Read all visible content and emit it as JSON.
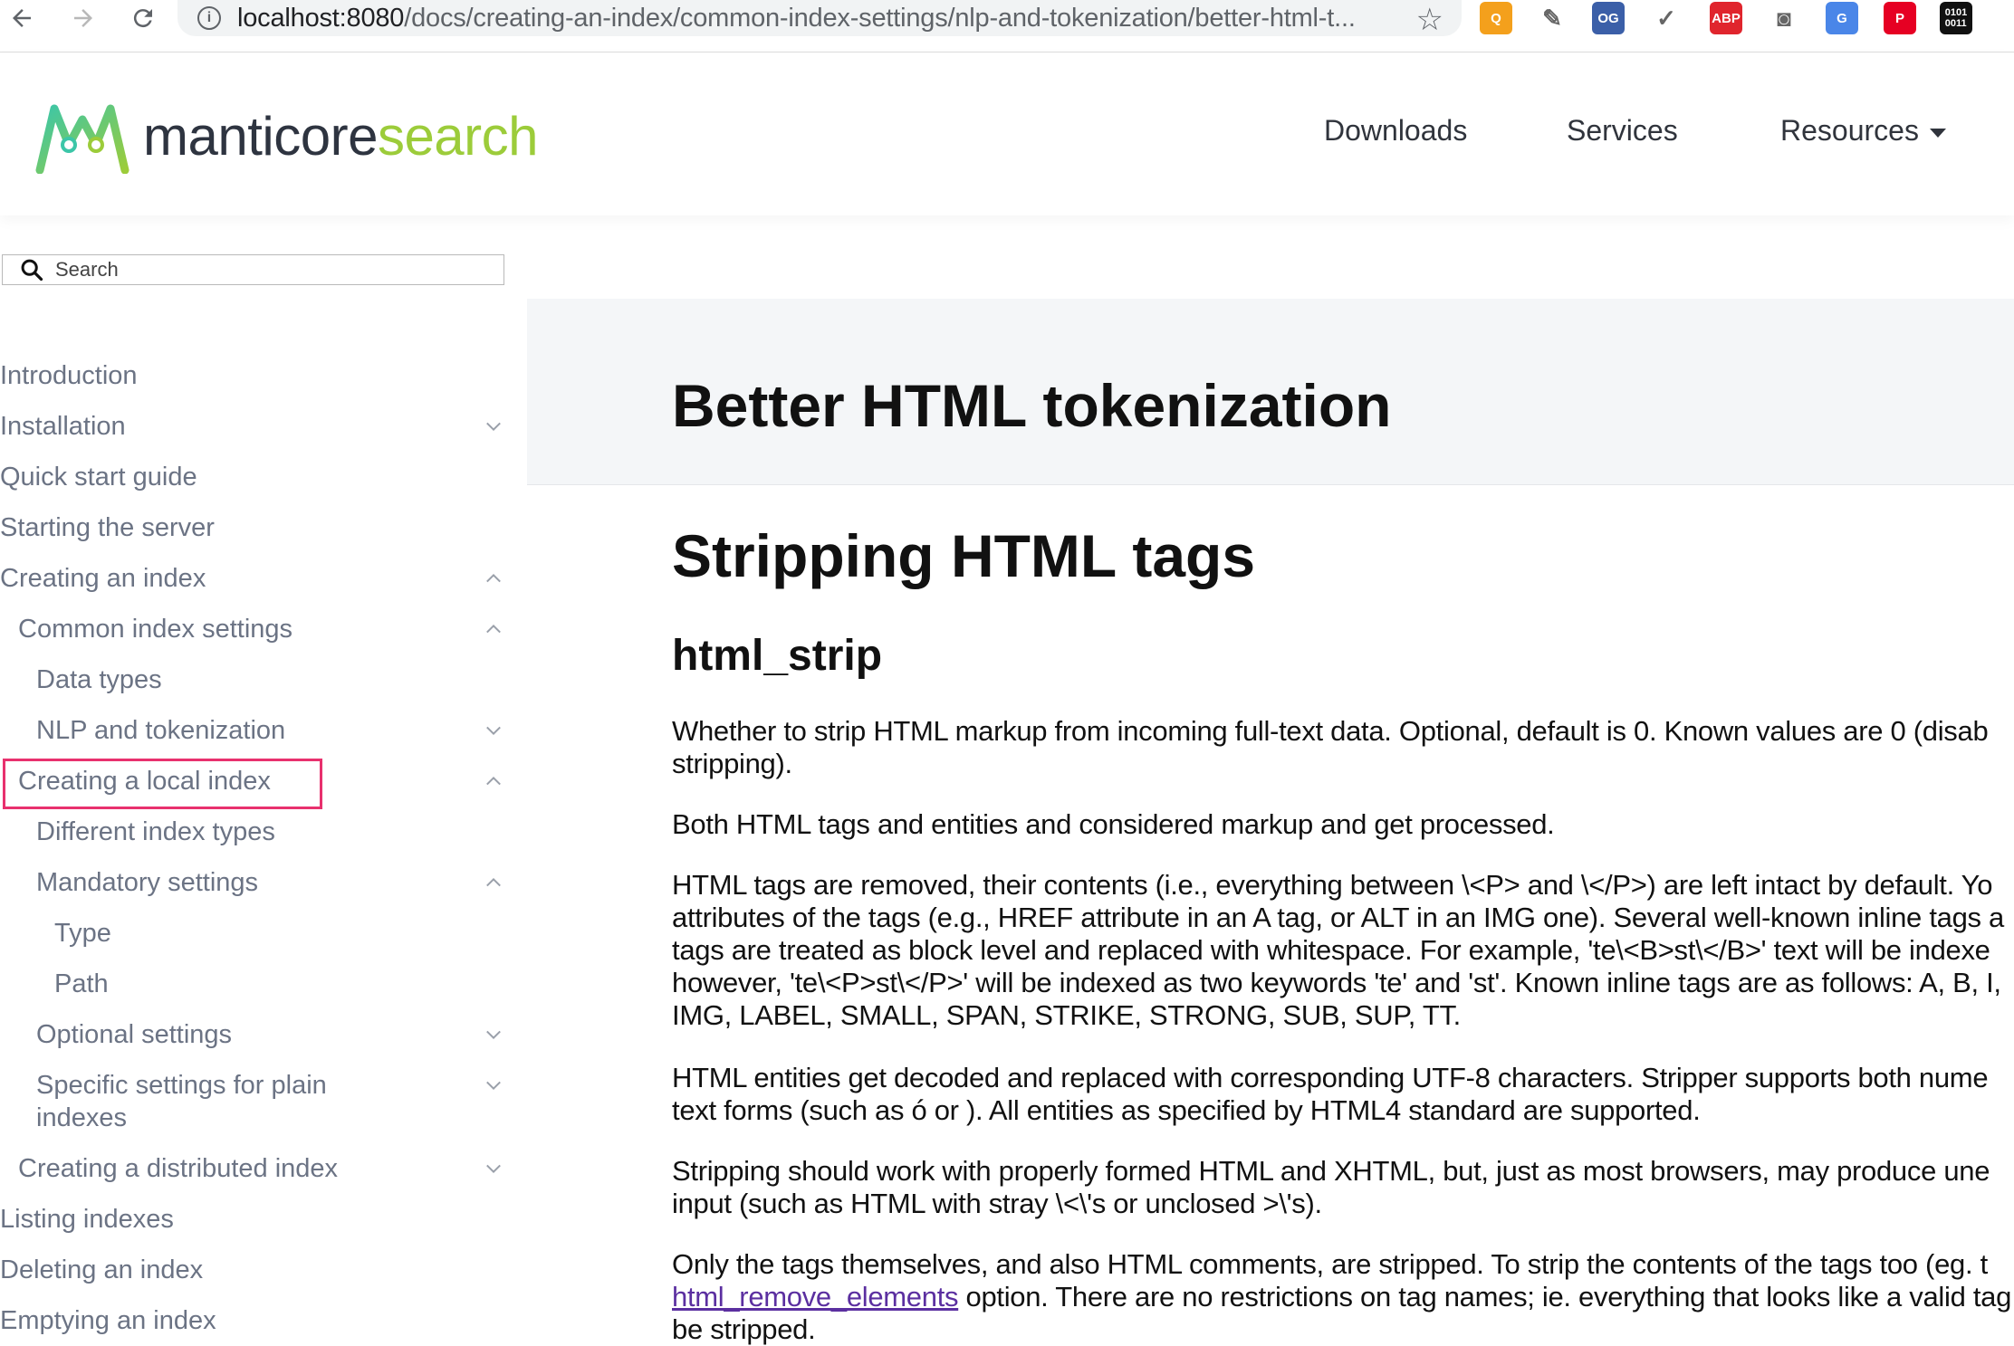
{
  "browser": {
    "url_host": "localhost:8080",
    "url_path": "/docs/creating-an-index/common-index-settings/nlp-and-tokenization/better-html-t...",
    "extensions": [
      {
        "name": "orange-search-extension-icon",
        "label": "Q",
        "color": "#f4a01c"
      },
      {
        "name": "eyedropper-extension-icon",
        "label": "",
        "color": "#ffffff"
      },
      {
        "name": "og-extension-icon",
        "label": "OG",
        "color": "#3b5fa8"
      },
      {
        "name": "check-extension-icon",
        "label": "",
        "color": "#ffffff"
      },
      {
        "name": "adblock-plus-extension-icon",
        "label": "ABP",
        "color": "#e0252d"
      },
      {
        "name": "camera-extension-icon",
        "label": "",
        "color": "#ffffff"
      },
      {
        "name": "translate-extension-icon",
        "label": "G",
        "color": "#4a86e8"
      },
      {
        "name": "pinterest-extension-icon",
        "label": "P",
        "color": "#e60023"
      },
      {
        "name": "binary-extension-icon",
        "label": "0101\n0011",
        "color": "#111111"
      }
    ]
  },
  "header": {
    "logo_main": "manticore",
    "logo_accent": "search",
    "nav": {
      "downloads": "Downloads",
      "services": "Services",
      "resources": "Resources"
    }
  },
  "sidebar": {
    "search_placeholder": "Search",
    "items": [
      {
        "label": "Introduction",
        "chevron": ""
      },
      {
        "label": "Installation",
        "chevron": "down"
      },
      {
        "label": "Quick start guide",
        "chevron": ""
      },
      {
        "label": "Starting the server",
        "chevron": ""
      },
      {
        "label": "Creating an index",
        "chevron": "up"
      },
      {
        "label": "Common index settings",
        "chevron": "up"
      },
      {
        "label": "Data types",
        "chevron": ""
      },
      {
        "label": "NLP and tokenization",
        "chevron": "down"
      },
      {
        "label": "Creating a local index",
        "chevron": "up"
      },
      {
        "label": "Different index types",
        "chevron": ""
      },
      {
        "label": "Mandatory settings",
        "chevron": "up"
      },
      {
        "label": "Type",
        "chevron": ""
      },
      {
        "label": "Path",
        "chevron": ""
      },
      {
        "label": "Optional settings",
        "chevron": "down"
      },
      {
        "label": "Specific settings for plain",
        "label2": "indexes",
        "chevron": "down"
      },
      {
        "label": "Creating a distributed index",
        "chevron": "down"
      },
      {
        "label": "Listing indexes",
        "chevron": ""
      },
      {
        "label": "Deleting an index",
        "chevron": ""
      },
      {
        "label": "Emptying an index",
        "chevron": ""
      }
    ]
  },
  "content": {
    "page_title": "Better HTML tokenization",
    "h2": "Stripping HTML tags",
    "h3": "html_strip",
    "paragraphs": [
      {
        "lines": [
          "Whether to strip HTML markup from incoming full-text data. Optional, default is 0. Known values are 0 (disab",
          "stripping)."
        ]
      },
      {
        "lines": [
          "Both HTML tags and entities and considered markup and get processed."
        ]
      },
      {
        "lines": [
          "HTML tags are removed, their contents (i.e., everything between \\<P> and \\</P>) are left intact by default. Yo",
          "attributes of the tags (e.g., HREF attribute in an A tag, or ALT in an IMG one). Several well-known inline tags a",
          "tags are treated as block level and replaced with whitespace. For example, 'te\\<B>st\\</B>' text will be indexe",
          "however, 'te\\<P>st\\</P>' will be indexed as two keywords 'te' and 'st'. Known inline tags are as follows: A, B, I,",
          "IMG, LABEL, SMALL, SPAN, STRIKE, STRONG, SUB, SUP, TT."
        ]
      },
      {
        "lines": [
          "HTML entities get decoded and replaced with corresponding UTF-8 characters. Stripper supports both nume",
          "text forms (such as ó or  ). All entities as specified by HTML4 standard are supported."
        ]
      },
      {
        "lines": [
          "Stripping should work with properly formed HTML and XHTML, but, just as most browsers, may produce une",
          "input (such as HTML with stray \\<\\'s or unclosed >\\'s)."
        ]
      },
      {
        "lines": [
          "Only the tags themselves, and also HTML comments, are stripped. To strip the contents of the tags too (eg. t"
        ]
      }
    ],
    "last_line_link": "html_remove_elements",
    "last_line_rest": " option. There are no restrictions on tag names; ie. everything that looks like a valid tag",
    "cutoff_line": "be stripped."
  },
  "colors": {
    "brand_dark": "#2e3440",
    "brand_accent": "#9ccc3a",
    "highlight_border": "#e8316e",
    "link": "#5b2fa0"
  }
}
